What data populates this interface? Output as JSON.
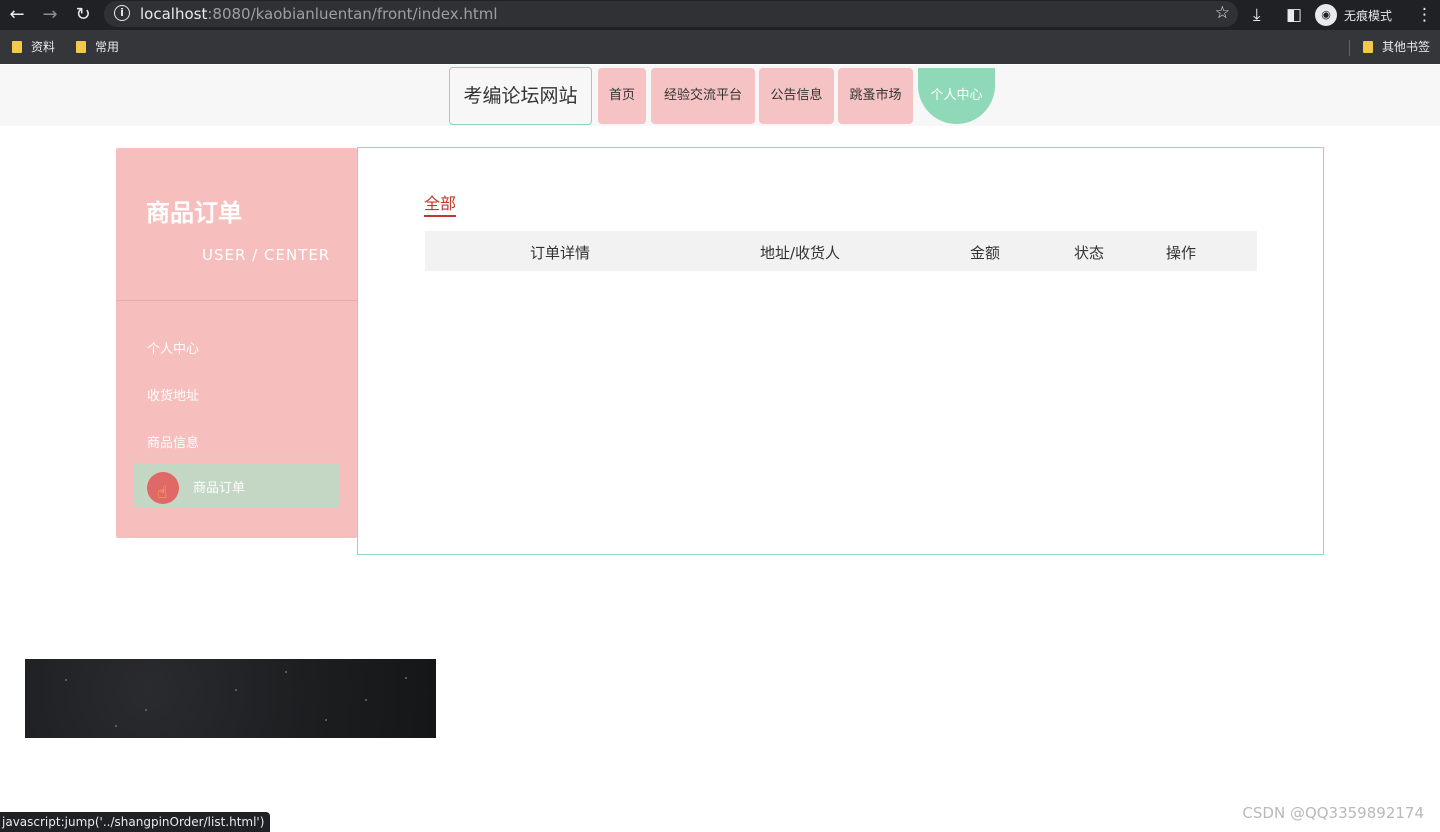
{
  "browser": {
    "url_host": "localhost",
    "url_rest": ":8080/kaobianluentan/front/index.html",
    "incognito_label": "无痕模式",
    "bookmarks": [
      "资料",
      "常用"
    ],
    "other_bookmarks": "其他书签"
  },
  "site": {
    "logo": "考编论坛网站",
    "nav": [
      "首页",
      "经验交流平台",
      "公告信息",
      "跳蚤市场"
    ],
    "nav_active": "个人中心"
  },
  "sidebar": {
    "title": "商品订单",
    "subtitle": "USER / CENTER",
    "items": [
      "个人中心",
      "收货地址",
      "商品信息"
    ],
    "active_item": "商品订单"
  },
  "content": {
    "tab": "全部",
    "columns": [
      "订单详情",
      "地址/收货人",
      "金额",
      "状态",
      "操作"
    ]
  },
  "status_bar": "javascript:jump('../shangpinOrder/list.html')",
  "watermark": "CSDN @QQ3359892174",
  "colors": {
    "accent_pink": "#f7bebe",
    "accent_green": "#8fd9b8",
    "tab_red": "#c0392b"
  }
}
